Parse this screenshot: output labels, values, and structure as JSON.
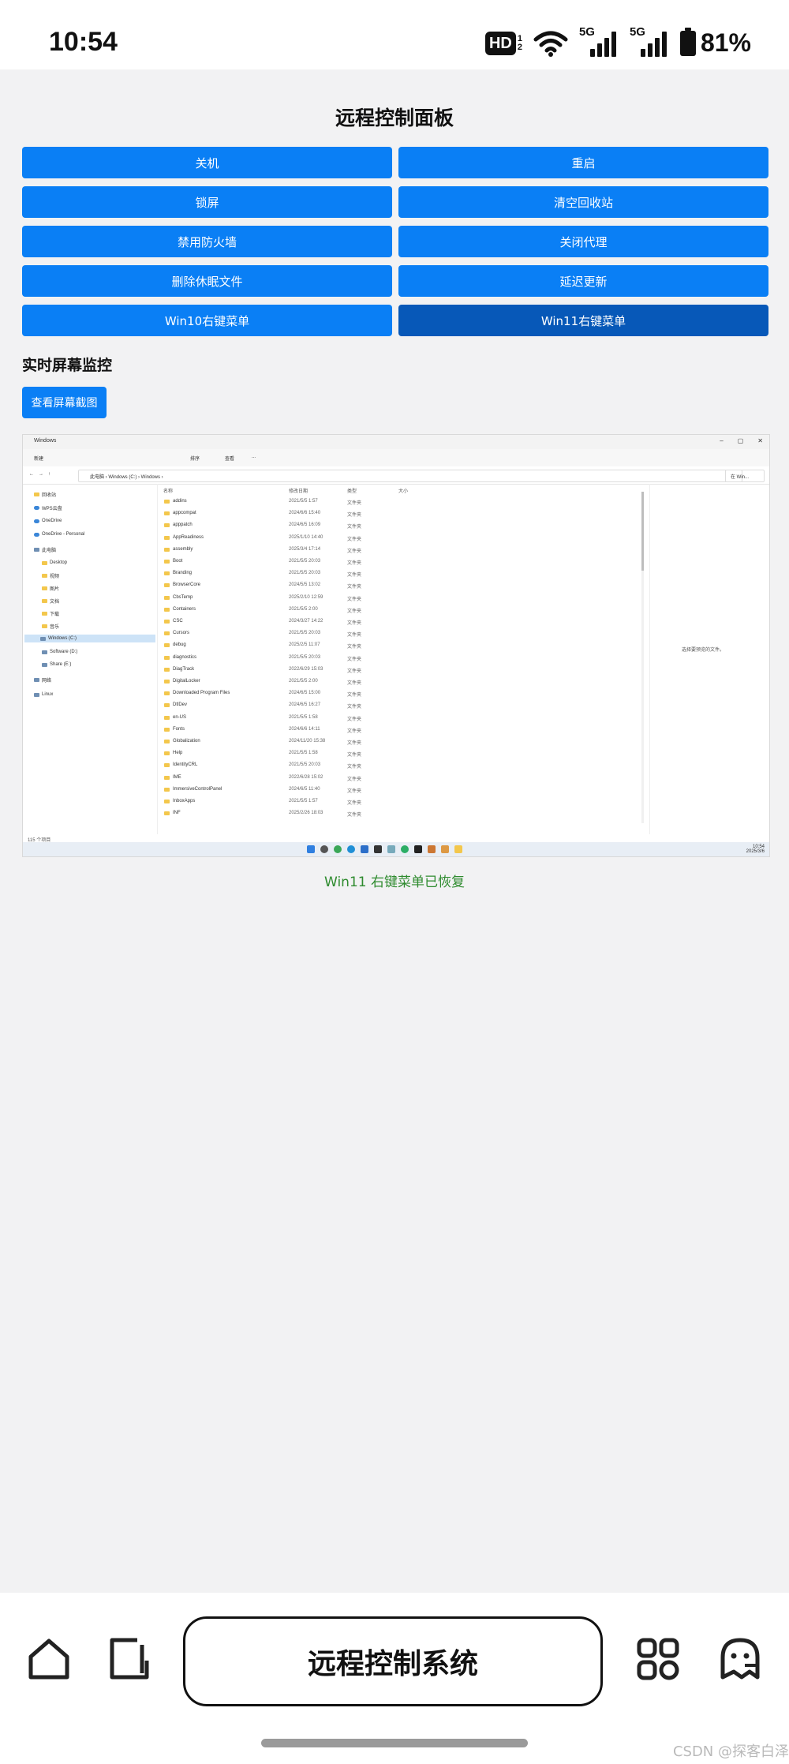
{
  "status_bar": {
    "time": "10:54",
    "hd_label": "HD",
    "hd_sub_top": "1",
    "hd_sub_bottom": "2",
    "network_1": "5G",
    "network_2": "5G",
    "battery": "81%"
  },
  "panel": {
    "title": "远程控制面板",
    "buttons": [
      {
        "label": "关机"
      },
      {
        "label": "重启"
      },
      {
        "label": "锁屏"
      },
      {
        "label": "清空回收站"
      },
      {
        "label": "禁用防火墙"
      },
      {
        "label": "关闭代理"
      },
      {
        "label": "删除休眠文件"
      },
      {
        "label": "延迟更新"
      },
      {
        "label": "Win10右键菜单"
      },
      {
        "label": "Win11右键菜单"
      }
    ],
    "active_button": "Win11右键菜单"
  },
  "monitor": {
    "title": "实时屏幕监控",
    "capture_label": "查看屏幕截图"
  },
  "screenshot": {
    "window_title": "Windows",
    "toolbar": [
      "新建",
      "排序",
      "查看",
      "..."
    ],
    "path": "此电脑 › Windows (C:) › Windows ›",
    "search_placeholder": "在 Win...",
    "sidebar": [
      {
        "label": "回收站",
        "icon": "folder"
      },
      {
        "label": "WPS云盘",
        "icon": "cloud"
      },
      {
        "label": "OneDrive",
        "icon": "cloud"
      },
      {
        "label": "OneDrive - Personal",
        "icon": "cloud"
      },
      {
        "label": "此电脑",
        "icon": "drive"
      },
      {
        "label": "Desktop",
        "icon": "folder"
      },
      {
        "label": "视频",
        "icon": "folder"
      },
      {
        "label": "图片",
        "icon": "folder"
      },
      {
        "label": "文档",
        "icon": "folder"
      },
      {
        "label": "下载",
        "icon": "folder"
      },
      {
        "label": "音乐",
        "icon": "folder"
      },
      {
        "label": "Windows (C:)",
        "icon": "drive"
      },
      {
        "label": "Software (D:)",
        "icon": "drive"
      },
      {
        "label": "Share (E:)",
        "icon": "drive"
      },
      {
        "label": "网络",
        "icon": "drive"
      },
      {
        "label": "Linux",
        "icon": "drive"
      }
    ],
    "columns": [
      "名称",
      "修改日期",
      "类型",
      "大小"
    ],
    "files": [
      {
        "name": "addins",
        "date": "2021/5/5 1:57",
        "type": "文件夹"
      },
      {
        "name": "appcompat",
        "date": "2024/6/6 15:40",
        "type": "文件夹"
      },
      {
        "name": "apppatch",
        "date": "2024/6/5 16:09",
        "type": "文件夹"
      },
      {
        "name": "AppReadiness",
        "date": "2025/1/10 14:40",
        "type": "文件夹"
      },
      {
        "name": "assembly",
        "date": "2025/3/4 17:14",
        "type": "文件夹"
      },
      {
        "name": "Boot",
        "date": "2021/5/5 20:03",
        "type": "文件夹"
      },
      {
        "name": "Branding",
        "date": "2021/5/5 20:03",
        "type": "文件夹"
      },
      {
        "name": "BrowserCore",
        "date": "2024/5/5 13:02",
        "type": "文件夹"
      },
      {
        "name": "CbsTemp",
        "date": "2025/2/10 12:59",
        "type": "文件夹"
      },
      {
        "name": "Containers",
        "date": "2021/5/5 2:00",
        "type": "文件夹"
      },
      {
        "name": "CSC",
        "date": "2024/3/27 14:22",
        "type": "文件夹"
      },
      {
        "name": "Cursors",
        "date": "2021/5/5 20:03",
        "type": "文件夹"
      },
      {
        "name": "debug",
        "date": "2025/2/5 11:07",
        "type": "文件夹"
      },
      {
        "name": "diagnostics",
        "date": "2021/5/5 20:03",
        "type": "文件夹"
      },
      {
        "name": "DiagTrack",
        "date": "2022/6/29 15:03",
        "type": "文件夹"
      },
      {
        "name": "DigitalLocker",
        "date": "2021/5/5 2:00",
        "type": "文件夹"
      },
      {
        "name": "Downloaded Program Files",
        "date": "2024/6/5 15:00",
        "type": "文件夹"
      },
      {
        "name": "DtlDev",
        "date": "2024/6/5 16:27",
        "type": "文件夹"
      },
      {
        "name": "en-US",
        "date": "2021/5/5 1:58",
        "type": "文件夹"
      },
      {
        "name": "Fonts",
        "date": "2024/6/6 14:11",
        "type": "文件夹"
      },
      {
        "name": "Globalization",
        "date": "2024/11/20 15:38",
        "type": "文件夹"
      },
      {
        "name": "Help",
        "date": "2021/5/5 1:58",
        "type": "文件夹"
      },
      {
        "name": "IdentityCRL",
        "date": "2021/5/5 20:03",
        "type": "文件夹"
      },
      {
        "name": "IME",
        "date": "2022/6/28 15:02",
        "type": "文件夹"
      },
      {
        "name": "ImmersiveControlPanel",
        "date": "2024/6/5 11:40",
        "type": "文件夹"
      },
      {
        "name": "InboxApps",
        "date": "2021/5/5 1:57",
        "type": "文件夹"
      },
      {
        "name": "INF",
        "date": "2025/2/26 18:03",
        "type": "文件夹"
      }
    ],
    "preview_text": "选择要预览的文件。",
    "status": "115 个项目",
    "tray_time": "10:54",
    "tray_date": "2025/3/6",
    "colors": {
      "folder": "#f3c74c",
      "selected_bg": "#cde3f7",
      "taskbar": "#e8eef5"
    }
  },
  "status_message": "Win11 右键菜单已恢复",
  "bottom_nav": {
    "center_label": "远程控制系统",
    "icons": [
      "home-icon",
      "page-icon",
      "grid-icon",
      "ghost-icon"
    ]
  },
  "watermark": "CSDN @探客白泽",
  "colors": {
    "primary": "#0a7ff5",
    "primary_active": "#0758b8",
    "success": "#2e8b2e",
    "background": "#f2f2f3"
  }
}
